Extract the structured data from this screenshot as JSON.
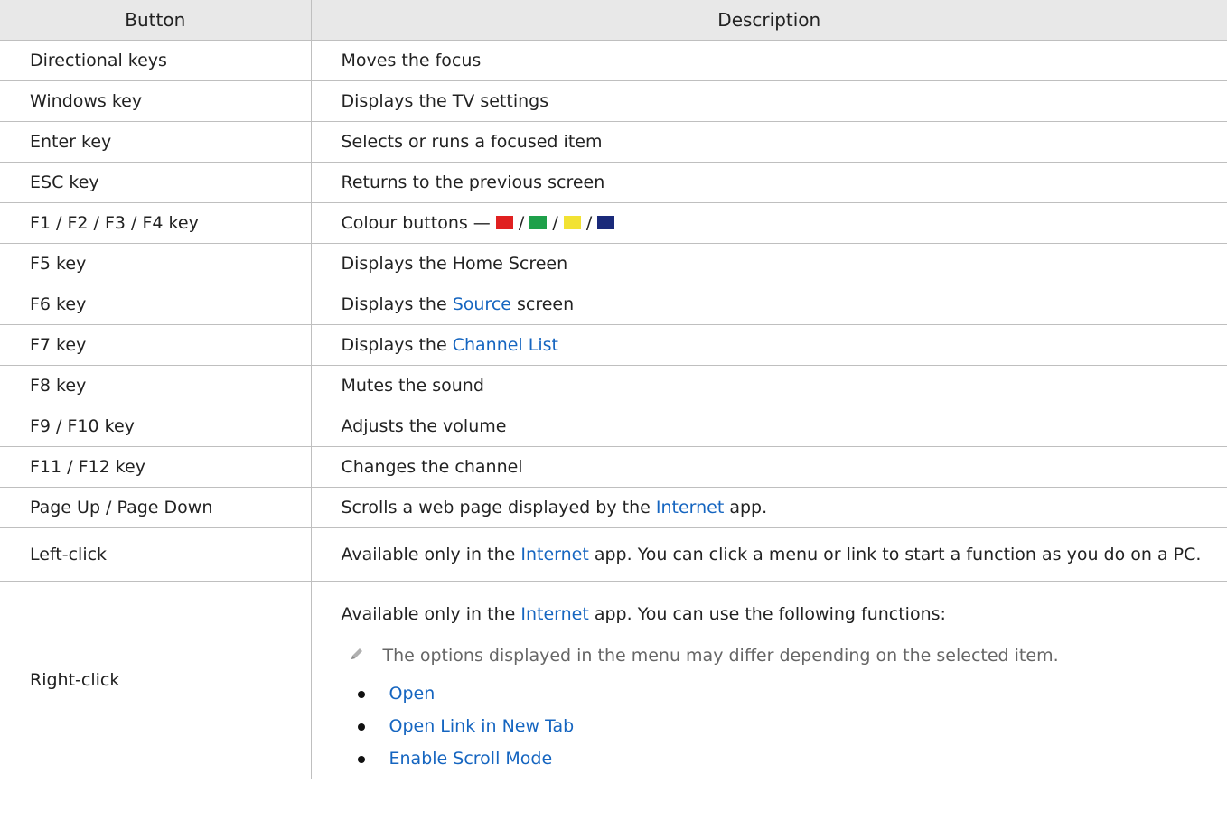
{
  "headers": {
    "button": "Button",
    "description": "Description"
  },
  "colors": {
    "red": "#e02020",
    "green": "#1ea04a",
    "yellow": "#f2e233",
    "blue": "#1a2a7a",
    "link": "#1565c0"
  },
  "rows": [
    {
      "button": "Directional keys",
      "description": "Moves the focus"
    },
    {
      "button": "Windows key",
      "description": "Displays the TV settings"
    },
    {
      "button": "Enter key",
      "description": "Selects or runs a focused item"
    },
    {
      "button": "ESC key",
      "description": "Returns to the previous screen"
    },
    {
      "button": "F1 / F2 / F3 / F4 key",
      "description": "Colour buttons — ",
      "sep": " / "
    },
    {
      "button": "F5 key",
      "description": "Displays the Home Screen"
    },
    {
      "button": "F6 key",
      "desc_before": "Displays the ",
      "desc_link": "Source",
      "desc_after": " screen"
    },
    {
      "button": "F7 key",
      "desc_before": "Displays the ",
      "desc_link": "Channel List",
      "desc_after": ""
    },
    {
      "button": "F8 key",
      "description": "Mutes the sound"
    },
    {
      "button": "F9 / F10 key",
      "description": "Adjusts the volume"
    },
    {
      "button": "F11 / F12 key",
      "description": "Changes the channel"
    },
    {
      "button": "Page Up / Page Down",
      "desc_before": "Scrolls a web page displayed by the ",
      "desc_link": "Internet",
      "desc_after": " app."
    },
    {
      "button": "Left-click",
      "desc_before": "Available only in the ",
      "desc_link": "Internet",
      "desc_after": " app. You can click a menu or link to start a function as you do on a PC."
    },
    {
      "button": "Right-click",
      "desc_before": "Available only in the ",
      "desc_link": "Internet",
      "desc_after": " app. You can use the following functions:",
      "note": "The options displayed in the menu may differ depending on the selected item.",
      "items": [
        "Open",
        "Open Link in New Tab",
        "Enable Scroll Mode"
      ]
    }
  ]
}
